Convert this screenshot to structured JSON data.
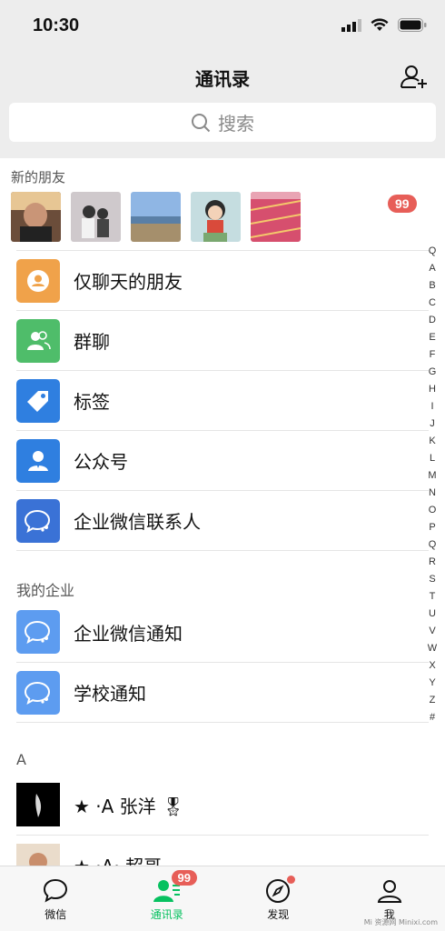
{
  "status": {
    "time": "10:30"
  },
  "nav": {
    "title": "通讯录"
  },
  "search": {
    "placeholder": "搜索"
  },
  "new_friends": {
    "label": "新的朋友",
    "badge": "99"
  },
  "menu": [
    {
      "label": "仅聊天的朋友",
      "color": "#f0a24a"
    },
    {
      "label": "群聊",
      "color": "#4fbd6a"
    },
    {
      "label": "标签",
      "color": "#2f7fe0"
    },
    {
      "label": "公众号",
      "color": "#2f7fe0"
    },
    {
      "label": "企业微信联系人",
      "color": "#3a72d6"
    }
  ],
  "enterprise": {
    "label": "我的企业",
    "items": [
      {
        "label": "企业微信通知",
        "color": "#5d9cf0"
      },
      {
        "label": "学校通知",
        "color": "#5d9cf0"
      }
    ]
  },
  "contacts": {
    "group_letter": "A",
    "items": [
      {
        "name": "★          ·A 张洋 🎖"
      },
      {
        "name": "★    ·A·  超哥"
      }
    ]
  },
  "index": [
    "Q",
    "A",
    "B",
    "C",
    "D",
    "E",
    "F",
    "G",
    "H",
    "I",
    "J",
    "K",
    "L",
    "M",
    "N",
    "O",
    "P",
    "Q",
    "R",
    "S",
    "T",
    "U",
    "V",
    "W",
    "X",
    "Y",
    "Z",
    "#"
  ],
  "tabs": [
    {
      "label": "微信"
    },
    {
      "label": "通讯录",
      "badge": "99"
    },
    {
      "label": "发现"
    },
    {
      "label": "我"
    }
  ],
  "watermark": "Mi 资源网 Minixi.com"
}
